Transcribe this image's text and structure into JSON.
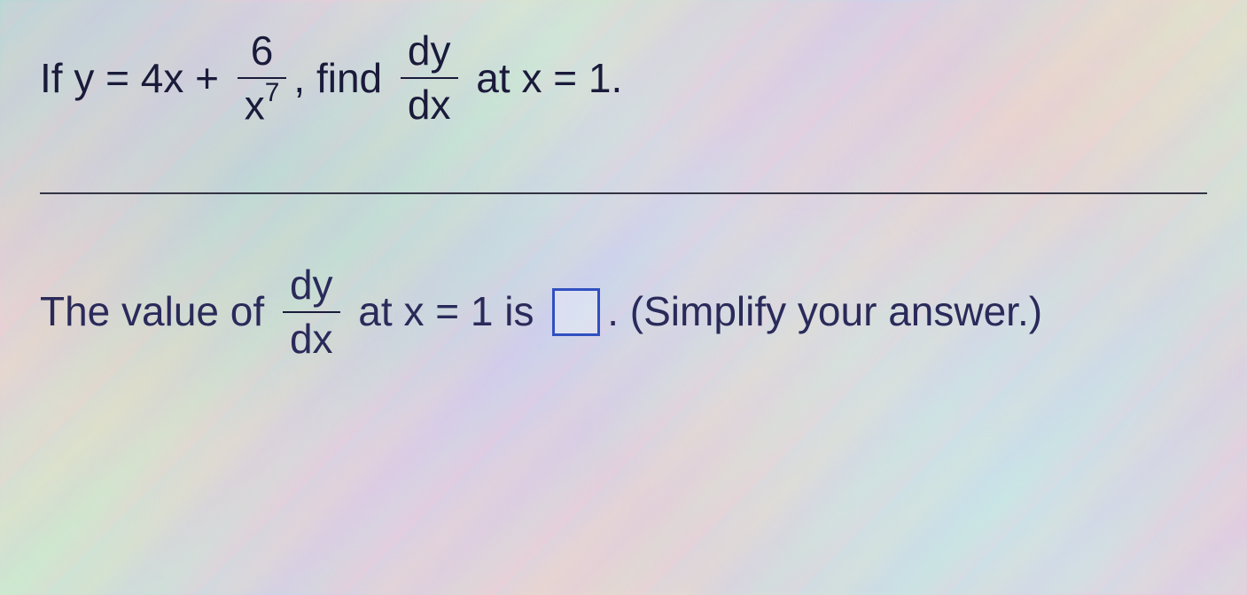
{
  "question": {
    "prefix": "If y = 4x + ",
    "fraction1": {
      "numerator": "6",
      "denominator_base": "x",
      "denominator_exponent": "7"
    },
    "middle1": ", find ",
    "fraction2": {
      "numerator": "dy",
      "denominator": "dx"
    },
    "suffix": " at x = 1."
  },
  "answer": {
    "prefix": "The value of ",
    "fraction": {
      "numerator": "dy",
      "denominator": "dx"
    },
    "middle": " at x = 1 is ",
    "suffix": ". (Simplify your answer.)"
  }
}
